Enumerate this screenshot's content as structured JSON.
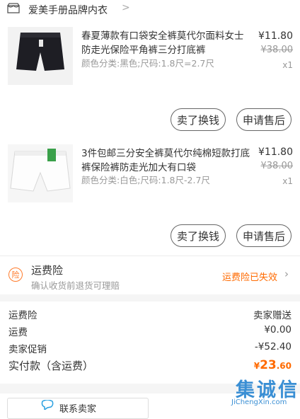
{
  "store": {
    "name": "爱美手册品牌内衣",
    "icon": "store-icon",
    "chevron": ">"
  },
  "items": [
    {
      "title": "春夏薄款有口袋安全裤莫代尔面料女士防走光保险平角裤三分打底裤",
      "spec": "颜色分类:黑色;尺码:1.8尺=2.7尺",
      "price": "¥11.80",
      "old_price": "¥38.00",
      "qty": "x1",
      "sell_label": "卖了换钱",
      "aftersale_label": "申请售后",
      "image": "black-shorts-image"
    },
    {
      "title": "3件包邮三分安全裤莫代尔纯棉短款打底裤保险裤防走光加大有口袋",
      "spec": "颜色分类:白色;尺码:1.8尺-2.7尺",
      "price": "¥11.80",
      "old_price": "¥38.00",
      "qty": "x1",
      "sell_label": "卖了换钱",
      "aftersale_label": "申请售后",
      "image": "white-shorts-image"
    }
  ],
  "insurance": {
    "icon_char": "险",
    "title": "运费险",
    "subtitle": "确认收货前退货可理赔",
    "status": "运费险已失效",
    "status_color": "#ff6a00"
  },
  "summary": [
    {
      "label": "运费险",
      "value": "卖家赠送"
    },
    {
      "label": "运费",
      "value": "¥0.00"
    },
    {
      "label": "卖家促销",
      "value": "-¥52.40"
    }
  ],
  "total": {
    "label": "实付款（含运费）",
    "currency": "¥",
    "integer": "23",
    "decimal": ".60"
  },
  "contact": {
    "label": "联系卖家"
  },
  "watermark": {
    "chars": "集诚信",
    "domain": "JiChengXin.com"
  },
  "colors": {
    "accent": "#ff6a00",
    "text": "#333333",
    "muted": "#999999"
  }
}
